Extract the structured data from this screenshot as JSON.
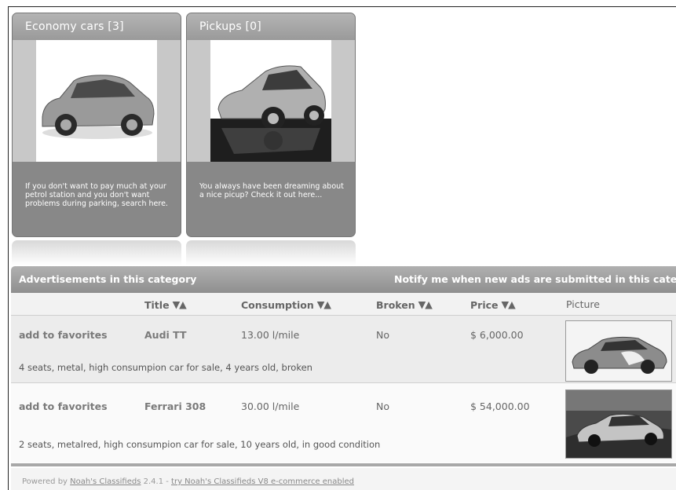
{
  "categories": [
    {
      "title": "Economy cars [3]",
      "description": "If you don't want to pay much at your petrol station and you don't want problems during parking, search here.",
      "image_icon": "car-photo"
    },
    {
      "title": "Pickups [0]",
      "description": "You always have been dreaming about a nice picup? Check it out here...",
      "image_icon": "car-photo"
    }
  ],
  "ads_section": {
    "heading": "Advertisements in this category",
    "notify_label": "Notify me when new ads are submitted in this cate"
  },
  "columns": {
    "title": "Title",
    "consumption": "Consumption",
    "broken": "Broken",
    "price": "Price",
    "picture": "Picture",
    "sort_glyph": "▼▲"
  },
  "ads": [
    {
      "favorite": "add to favorites",
      "title": "Audi TT",
      "consumption": "13.00 l/mile",
      "broken": "No",
      "price": "$ 6,000.00",
      "description": "4 seats, metal, high consumpion car for sale, 4 years old, broken"
    },
    {
      "favorite": "add to favorites",
      "title": "Ferrari 308",
      "consumption": "30.00 l/mile",
      "broken": "No",
      "price": "$ 54,000.00",
      "description": "2 seats, metalred, high consumpion car for sale, 10 years old, in good condition"
    }
  ],
  "footer": {
    "prefix": "Powered by ",
    "brand_link": "Noah's Classifieds",
    "version": " 2.4.1 - ",
    "promo_link": "try Noah's Classifieds V8 e-commerce enabled"
  }
}
